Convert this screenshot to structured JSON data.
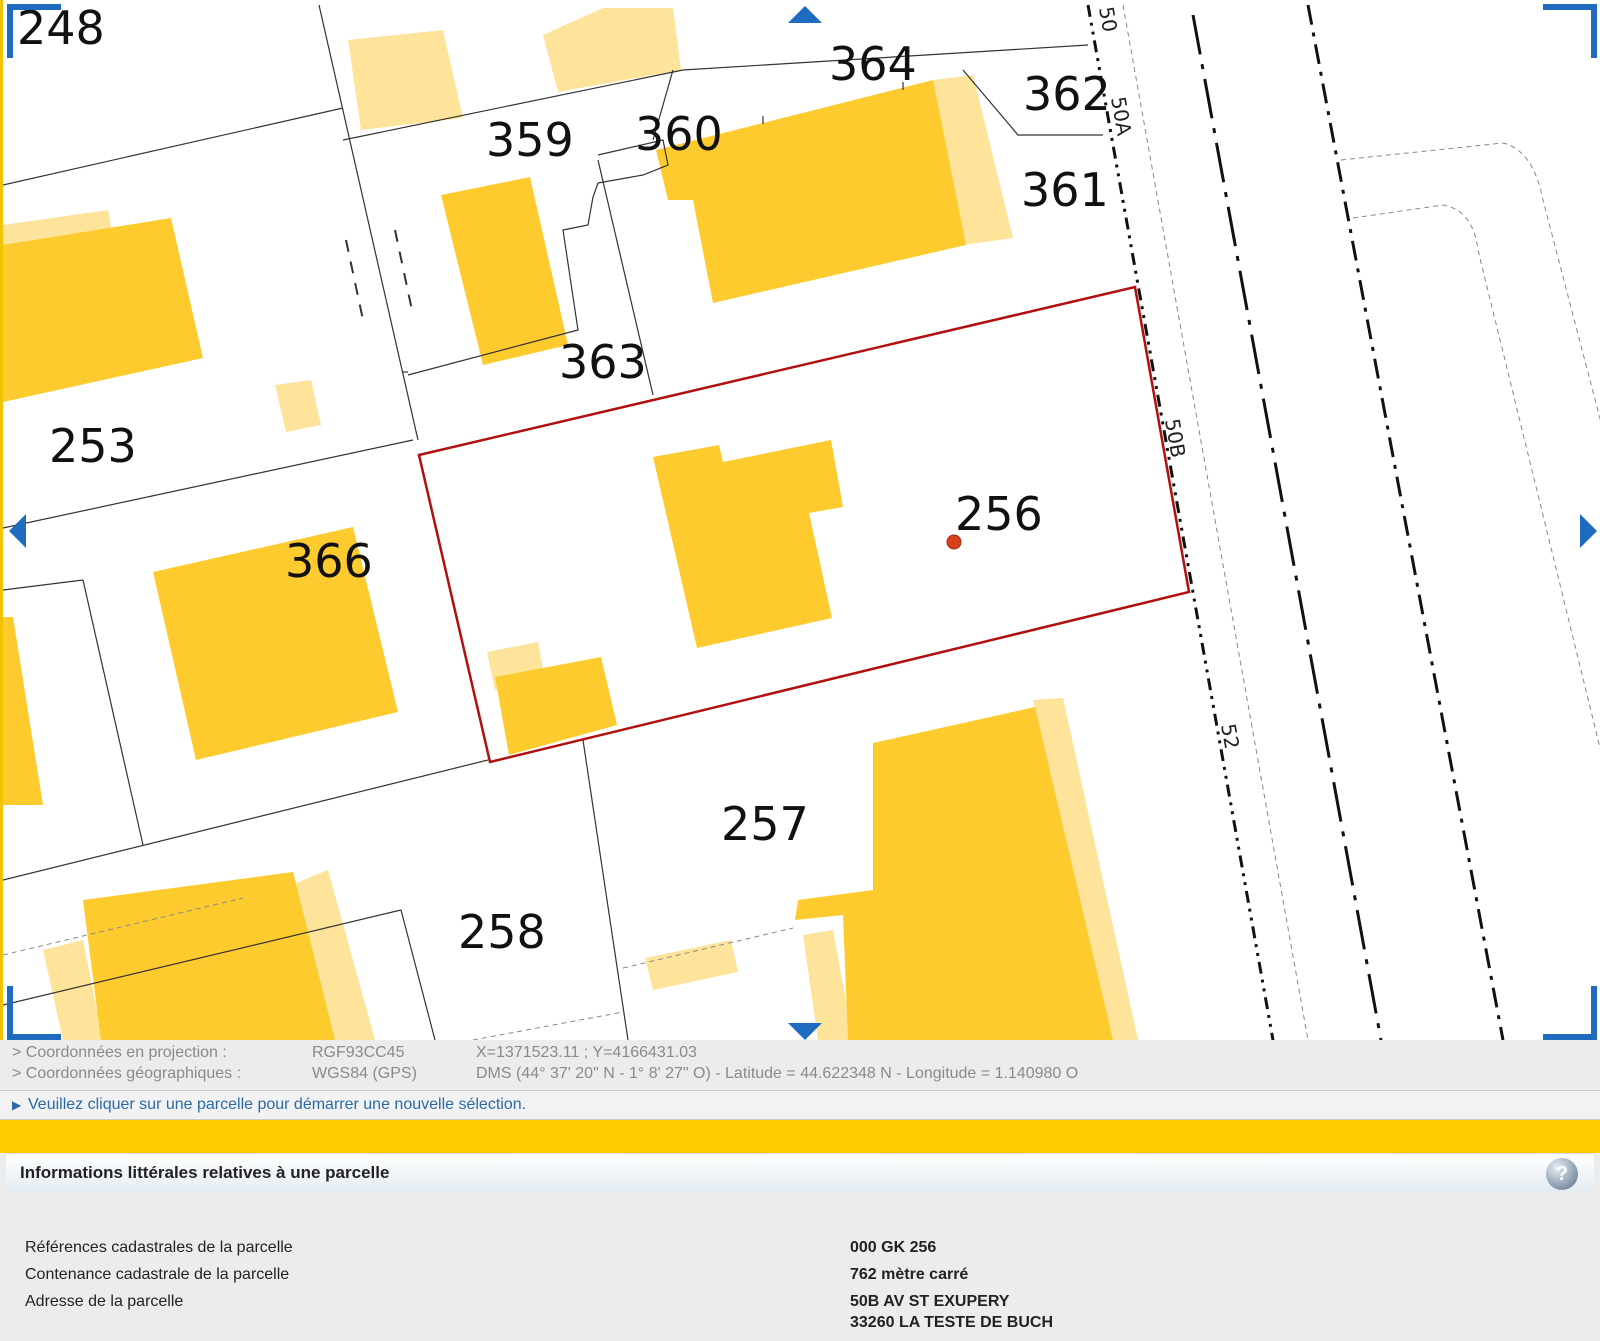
{
  "map": {
    "parcel_labels": {
      "p248": "248",
      "p364": "364",
      "p362": "362",
      "p359": "359",
      "p360": "360",
      "p361": "361",
      "p363": "363",
      "p253": "253",
      "p366": "366",
      "p256": "256",
      "p257": "257",
      "p258": "258"
    },
    "street_numbers": {
      "n50": "50",
      "n50a": "50A",
      "n50b": "50B",
      "n52": "52"
    },
    "colors": {
      "building": "#fecb2f",
      "building_light": "#fee49a",
      "selected_parcel_outline": "#b01010",
      "nav_blue": "#1f6bbf",
      "frame_yellow": "#f2c300"
    }
  },
  "coordinates": {
    "projection": {
      "label": "> Coordonnées en projection :",
      "system": "RGF93CC45",
      "value": "X=1371523.11 ; Y=4166431.03"
    },
    "geographic": {
      "label": "> Coordonnées géographiques :",
      "system": "WGS84 (GPS)",
      "value": "DMS (44° 37' 20\" N - 1° 8' 27\" O) - Latitude = 44.622348 N - Longitude = 1.140980 O"
    }
  },
  "hint": {
    "arrow": "▶",
    "text": "Veuillez cliquer sur une parcelle pour démarrer une nouvelle sélection."
  },
  "panel": {
    "title": "Informations littérales relatives à une parcelle",
    "help": "?",
    "rows": [
      {
        "label": "Références cadastrales de la parcelle",
        "value": "000 GK 256"
      },
      {
        "label": "Contenance cadastrale de la parcelle",
        "value": "762 mètre carré"
      },
      {
        "label": "Adresse de la parcelle",
        "value": "50B AV ST EXUPERY",
        "value2": "33260 LA TESTE DE BUCH"
      }
    ]
  }
}
